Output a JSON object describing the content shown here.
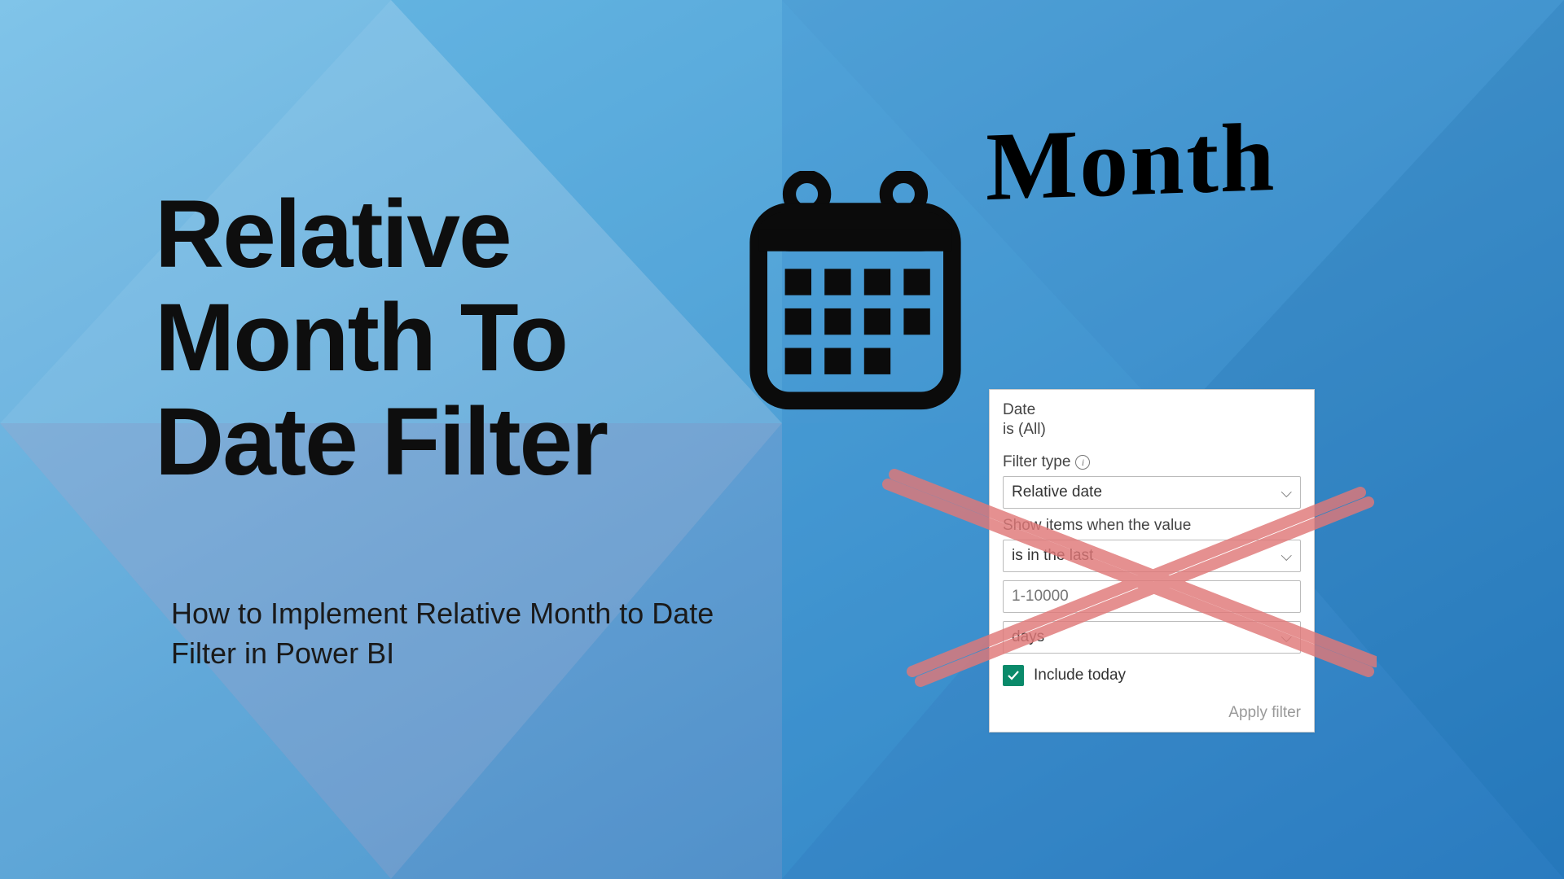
{
  "title": "Relative\nMonth To\nDate Filter",
  "subtitle": "How to Implement Relative Month to Date Filter in Power BI",
  "decorative_label": "Month",
  "filter_panel": {
    "field_name": "Date",
    "field_status": "is (All)",
    "filter_type_label": "Filter type",
    "filter_type_value": "Relative date",
    "show_items_label": "Show items when the value",
    "operator_value": "is in the last",
    "range_placeholder": "1-10000",
    "unit_value": "days",
    "include_today_label": "Include today",
    "include_today_checked": true,
    "apply_label": "Apply filter"
  }
}
